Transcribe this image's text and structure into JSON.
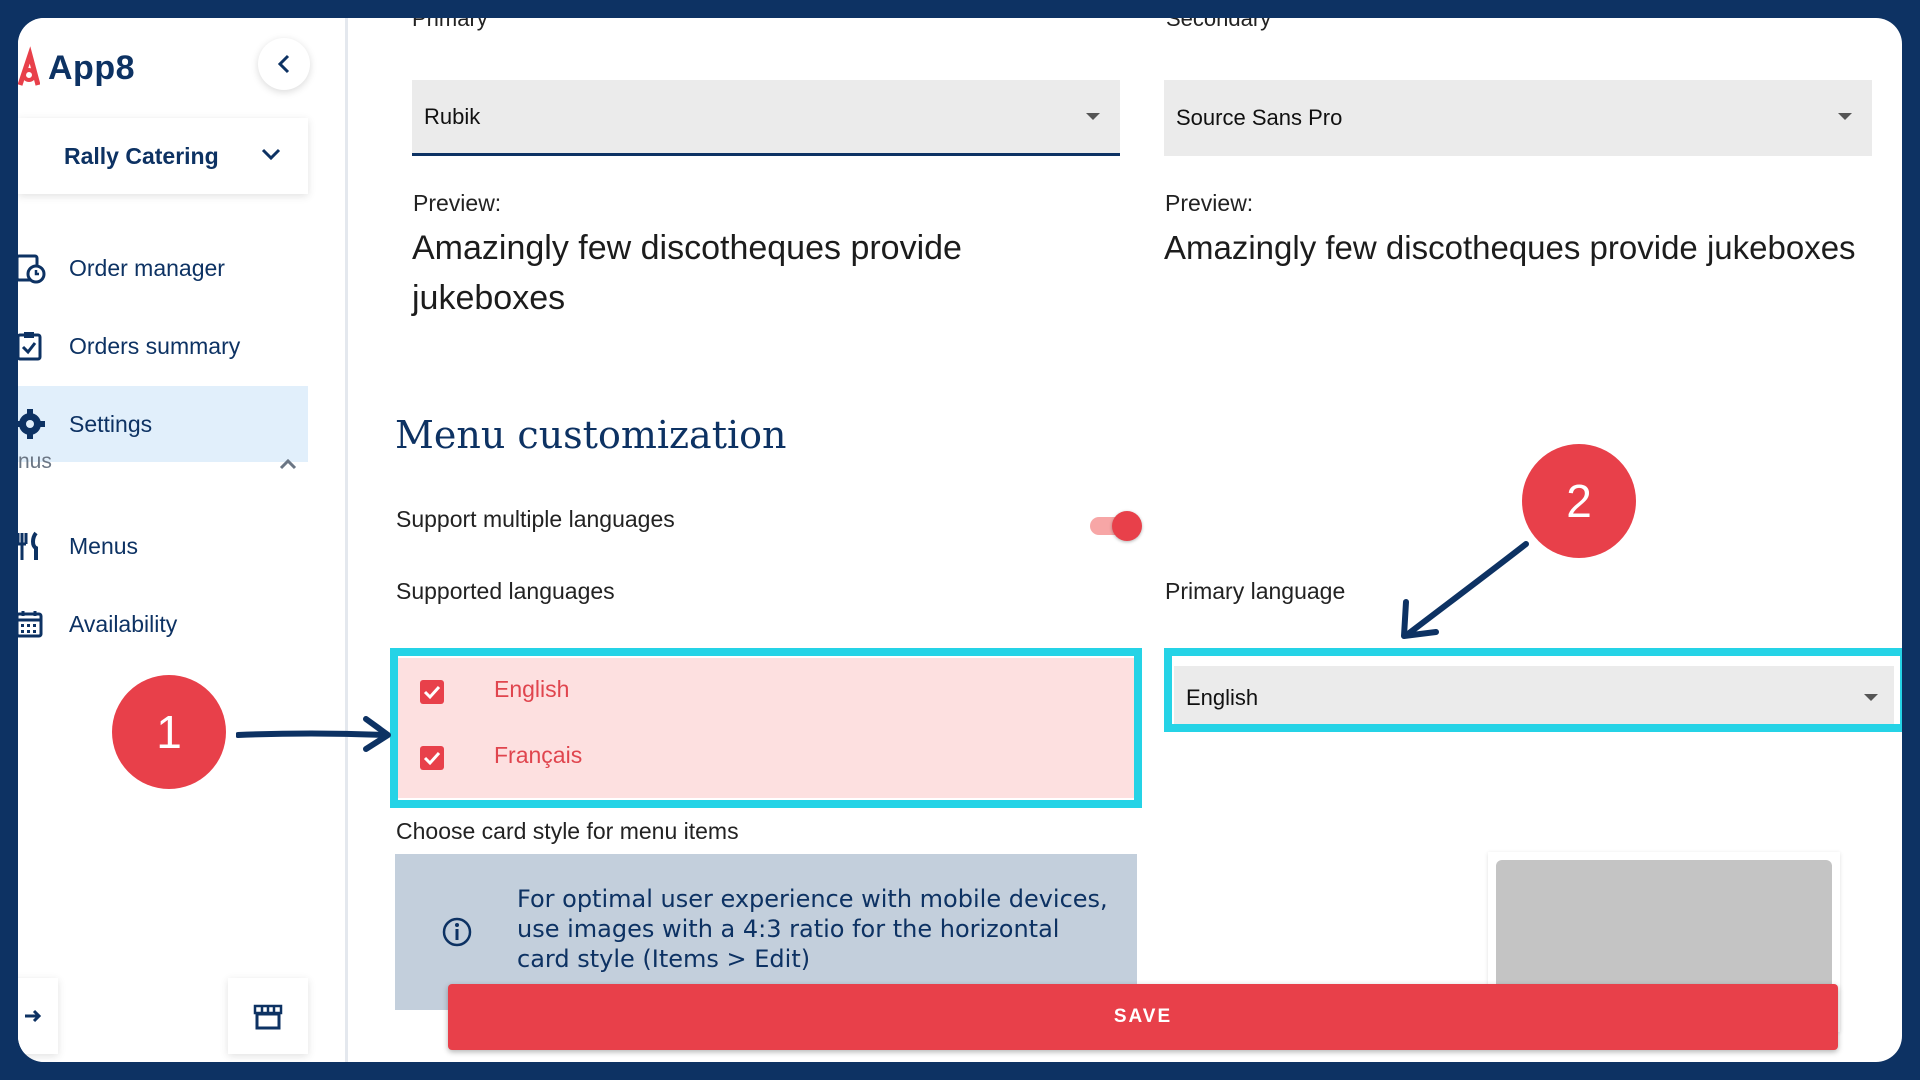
{
  "app": {
    "name": "App8"
  },
  "sidebar": {
    "collapse_icon": "chevron-left-icon",
    "org_name": "Rally Catering",
    "items": [
      {
        "label": "Order manager",
        "icon": "clock-document-icon"
      },
      {
        "label": "Orders summary",
        "icon": "clipboard-check-icon"
      },
      {
        "label": "Settings",
        "icon": "gear-icon",
        "active": true
      }
    ],
    "group_label": "nus",
    "group_items": [
      {
        "label": "Menus",
        "icon": "utensils-icon"
      },
      {
        "label": "Availability",
        "icon": "calendar-icon"
      }
    ],
    "bottom_left_icon": "logout-arrow-icon",
    "bottom_right_icon": "store-icon"
  },
  "fonts": {
    "primary_label": "Primary",
    "primary_value": "Rubik",
    "secondary_label": "Secondary",
    "secondary_value": "Source Sans Pro",
    "preview_label": "Preview:",
    "preview_text_line1": "Amazingly few discotheques provide",
    "preview_text_line2": "jukeboxes",
    "preview_text_secondary": "Amazingly few discotheques provide jukeboxes"
  },
  "menu_customization": {
    "title": "Menu customization",
    "support_multiple_label": "Support multiple languages",
    "support_multiple_enabled": true,
    "supported_languages_label": "Supported languages",
    "languages": [
      {
        "label": "English",
        "checked": true
      },
      {
        "label": "Français",
        "checked": true
      }
    ],
    "primary_language_label": "Primary language",
    "primary_language_value": "English",
    "card_style_label": "Choose card style for menu items",
    "info_text": "For optimal user experience with mobile devices, use images with a 4:3 ratio for the horizontal card style (Items > Edit)"
  },
  "actions": {
    "save_label": "SAVE"
  },
  "annotations": {
    "badge_1": "1",
    "badge_2": "2"
  },
  "colors": {
    "brand_navy": "#0d3263",
    "accent_red": "#e8404a",
    "highlight_cyan": "#25d3e6",
    "active_nav_bg": "#e1effb"
  }
}
